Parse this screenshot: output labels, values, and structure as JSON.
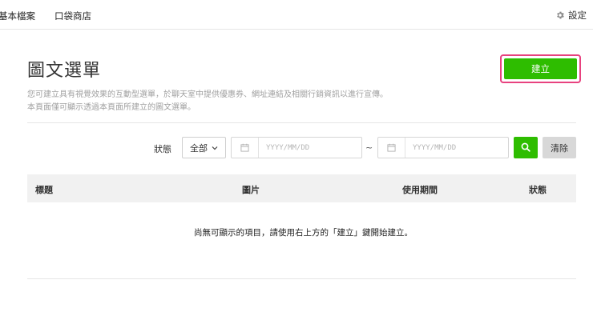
{
  "topbar": {
    "nav": [
      "基本檔案",
      "口袋商店"
    ],
    "settings_label": "設定"
  },
  "page": {
    "title": "圖文選單",
    "description_lines": [
      "您可建立具有視覺效果的互動型選單，於聊天室中提供優惠券、網址連結及相關行銷資訊以進行宣傳。",
      "本頁面僅可顯示透過本頁面所建立的圖文選單。"
    ],
    "create_label": "建立"
  },
  "filter": {
    "status_label": "狀態",
    "status_value": "全部",
    "date_start_placeholder": "YYYY/MM/DD",
    "date_end_placeholder": "YYYY/MM/DD",
    "separator": "~",
    "clear_label": "清除"
  },
  "table": {
    "columns": [
      "標題",
      "圖片",
      "使用期間",
      "狀態"
    ],
    "empty_message": "尚無可顯示的項目，請使用右上方的「建立」鍵開始建立。"
  },
  "colors": {
    "accent_green": "#2ebd00",
    "highlight_pink": "#e8427f"
  },
  "icons": [
    "gear-icon",
    "calendar-icon",
    "chevron-down-icon",
    "search-icon"
  ]
}
